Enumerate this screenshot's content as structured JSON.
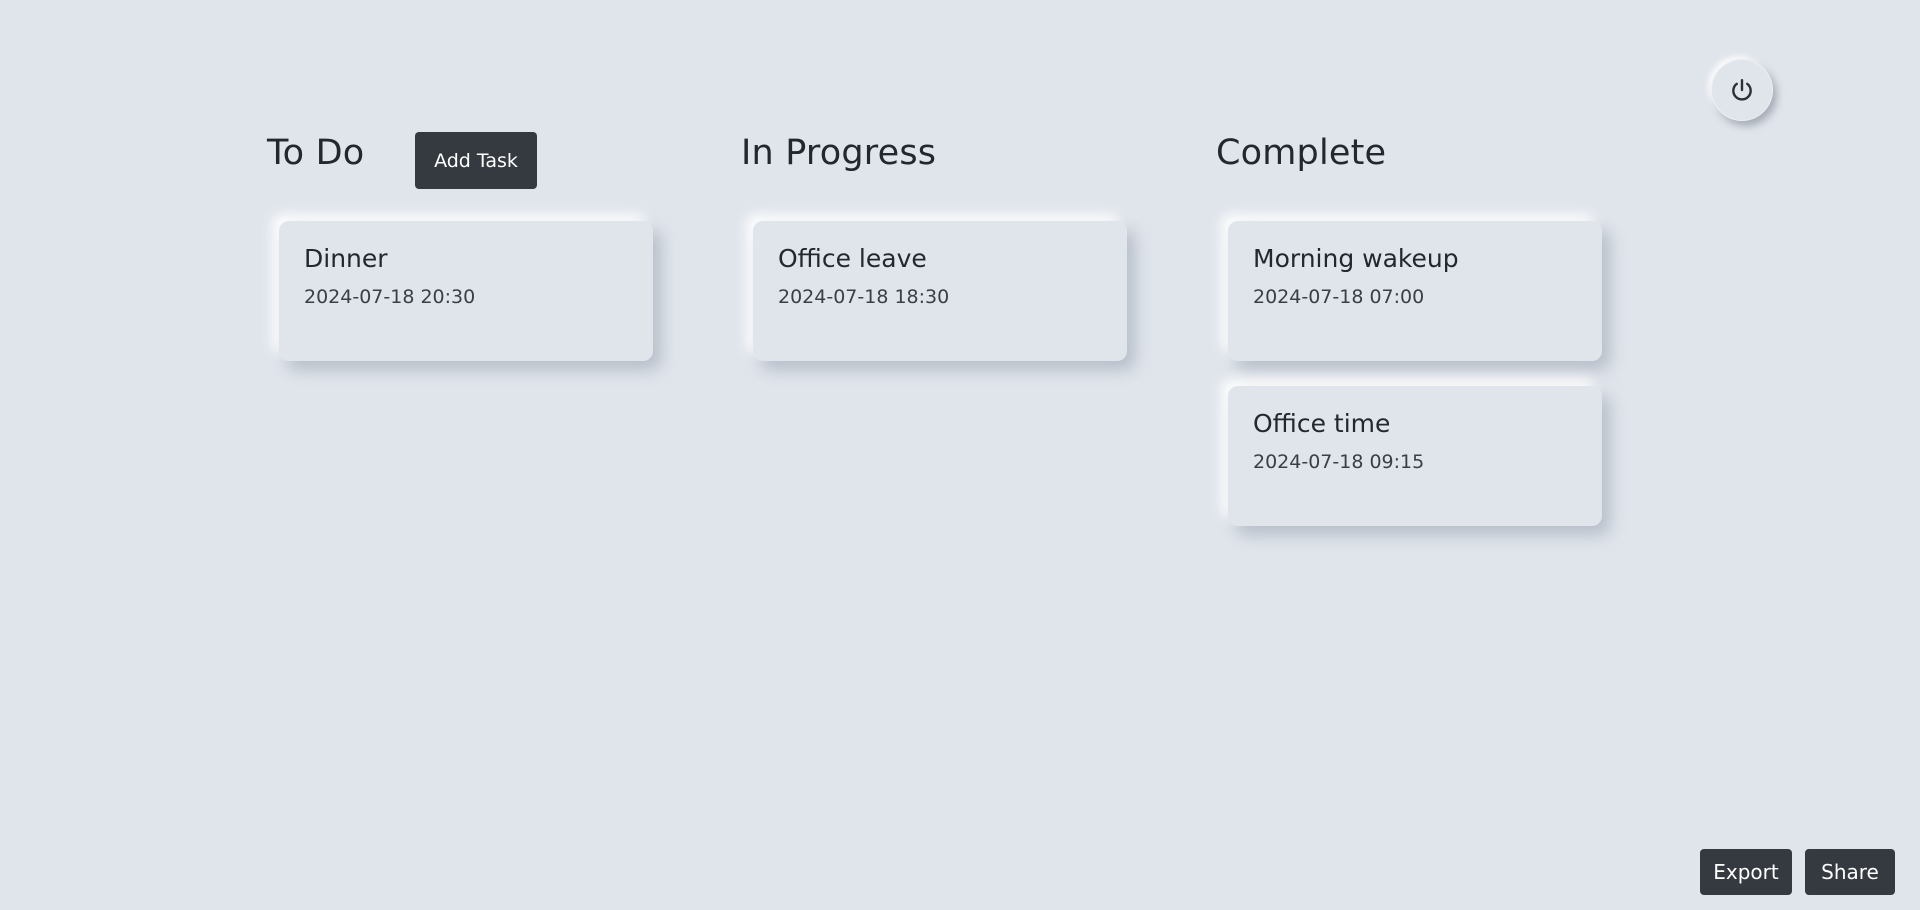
{
  "header": {
    "power_icon": "power-icon"
  },
  "columns": [
    {
      "title": "To Do",
      "add_task_label": "Add Task",
      "cards": [
        {
          "title": "Dinner",
          "time": "2024-07-18 20:30"
        }
      ]
    },
    {
      "title": "In Progress",
      "cards": [
        {
          "title": "Office leave",
          "time": "2024-07-18 18:30"
        }
      ]
    },
    {
      "title": "Complete",
      "cards": [
        {
          "title": "Morning wakeup",
          "time": "2024-07-18 07:00"
        },
        {
          "title": "Office time",
          "time": "2024-07-18 09:15"
        }
      ]
    }
  ],
  "footer": {
    "export_label": "Export",
    "share_label": "Share"
  },
  "colors": {
    "background": "#e0e5ec",
    "button": "#343a40",
    "text": "#23272e"
  }
}
